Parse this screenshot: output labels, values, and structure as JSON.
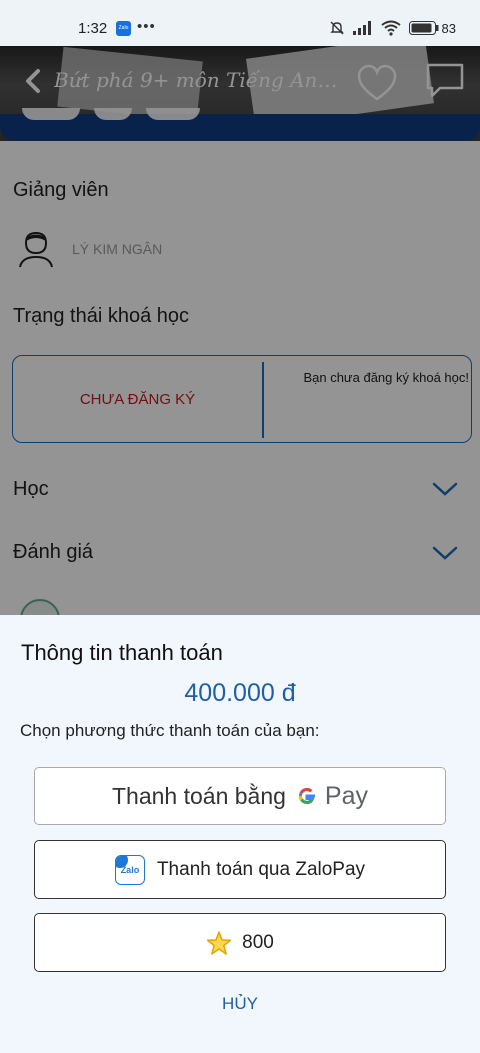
{
  "status_bar": {
    "time": "1:32",
    "dots": "•••",
    "battery": "83"
  },
  "header": {
    "title": "Bứt phá 9+ môn Tiếng Anh..."
  },
  "teacher": {
    "heading": "Giảng viên",
    "name": "LÝ KIM NGÂN"
  },
  "course_status": {
    "heading": "Trạng thái khoá học",
    "state": "CHƯA ĐĂNG KÝ",
    "message": "Bạn chưa đăng ký khoá học!"
  },
  "sections": {
    "learn": "Học",
    "review": "Đánh giá"
  },
  "payment": {
    "title": "Thông tin thanh toán",
    "amount": "400.000 đ",
    "prompt": "Chọn phương thức thanh toán của bạn:",
    "gpay_label": "Thanh toán bằng",
    "gpay_brand": "Pay",
    "gpay_g": "G",
    "zalopay_label": "Thanh toán qua ZaloPay",
    "zalo_logo_text": "Zalo",
    "stars_value": "800",
    "cancel": "HỦY"
  },
  "colors": {
    "accent": "#1f5fa6",
    "status_red": "#c41a1a",
    "header_band": "#0f3c83"
  }
}
